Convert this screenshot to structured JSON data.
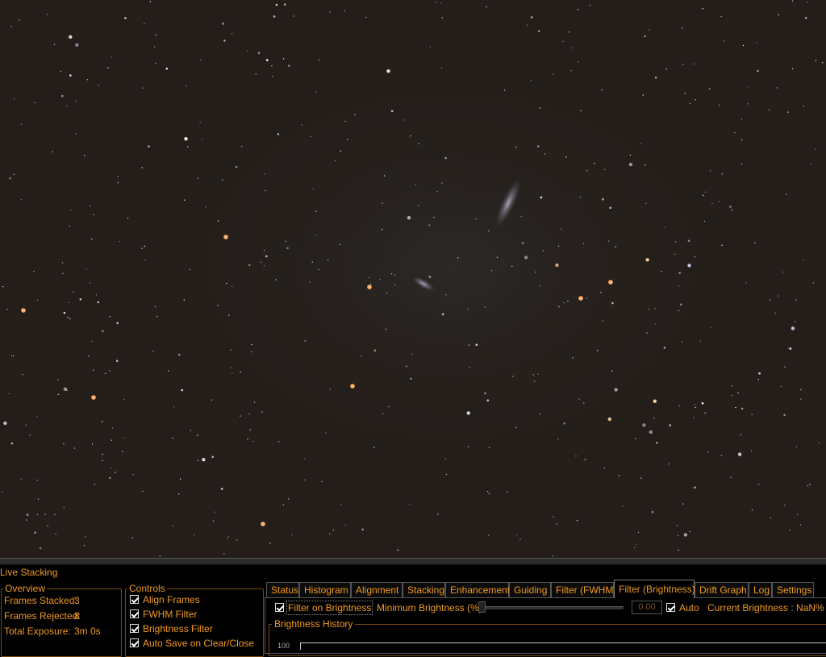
{
  "panel": {
    "title": "Live Stacking",
    "overview": {
      "legend": "Overview",
      "frames_stacked_label": "Frames Stacked:",
      "frames_stacked_value": "3",
      "frames_rejected_label": "Frames Rejected:",
      "frames_rejected_value": "8",
      "total_exposure_label": "Total Exposure:",
      "total_exposure_value": "3m 0s"
    },
    "controls": {
      "legend": "Controls",
      "items": [
        {
          "label": "Align Frames",
          "checked": true
        },
        {
          "label": "FWHM Filter",
          "checked": true
        },
        {
          "label": "Brightness Filter",
          "checked": true
        },
        {
          "label": "Auto Save on Clear/Close",
          "checked": true
        }
      ]
    },
    "tabs": [
      {
        "label": "Status"
      },
      {
        "label": "Histogram"
      },
      {
        "label": "Alignment"
      },
      {
        "label": "Stacking"
      },
      {
        "label": "Enhancement"
      },
      {
        "label": "Guiding"
      },
      {
        "label": "Filter (FWHM)"
      },
      {
        "label": "Filter (Brightness)",
        "active": true
      },
      {
        "label": "Drift Graph"
      },
      {
        "label": "Log"
      },
      {
        "label": "Settings"
      }
    ],
    "brightness_tab": {
      "filter_on_brightness_label": "Filter on Brightness",
      "filter_on_brightness_checked": true,
      "min_brightness_label": "Minimum Brightness (%)",
      "min_brightness_value": "0.00",
      "auto_label": "Auto",
      "auto_checked": true,
      "current_brightness_text": "Current Brightness : NaN% of",
      "history_legend": "Brightness History",
      "history_top_tick": "100"
    }
  },
  "colors": {
    "accent": "#f09a1e",
    "sky_background": "#241d1a",
    "panel_background": "#000000"
  }
}
